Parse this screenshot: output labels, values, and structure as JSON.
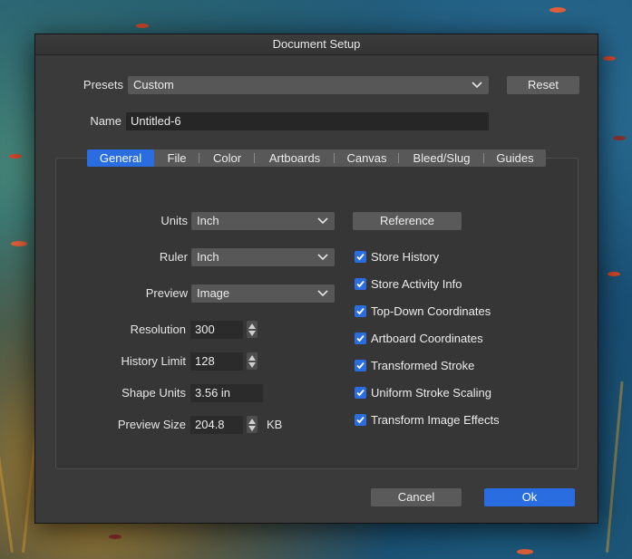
{
  "dialog": {
    "title": "Document Setup"
  },
  "presets": {
    "label": "Presets",
    "value": "Custom",
    "reset_label": "Reset"
  },
  "name": {
    "label": "Name",
    "value": "Untitled-6"
  },
  "tabs": [
    {
      "label": "General",
      "active": true
    },
    {
      "label": "File"
    },
    {
      "label": "Color"
    },
    {
      "label": "Artboards"
    },
    {
      "label": "Canvas"
    },
    {
      "label": "Bleed/Slug"
    },
    {
      "label": "Guides"
    }
  ],
  "general": {
    "units": {
      "label": "Units",
      "value": "Inch"
    },
    "ruler": {
      "label": "Ruler",
      "value": "Inch"
    },
    "preview": {
      "label": "Preview",
      "value": "Image"
    },
    "resolution": {
      "label": "Resolution",
      "value": "300"
    },
    "history_limit": {
      "label": "History Limit",
      "value": "128"
    },
    "shape_units": {
      "label": "Shape Units",
      "value": "3.56 in"
    },
    "preview_size": {
      "label": "Preview Size",
      "value": "204.8",
      "unit": "KB"
    },
    "reference_label": "Reference",
    "options": [
      {
        "label": "Store History",
        "checked": true
      },
      {
        "label": "Store Activity Info",
        "checked": true
      },
      {
        "label": "Top-Down Coordinates",
        "checked": true
      },
      {
        "label": "Artboard Coordinates",
        "checked": true
      },
      {
        "label": "Transformed Stroke",
        "checked": true
      },
      {
        "label": "Uniform Stroke Scaling",
        "checked": true
      },
      {
        "label": "Transform Image Effects",
        "checked": true
      }
    ]
  },
  "footer": {
    "cancel_label": "Cancel",
    "ok_label": "Ok"
  },
  "colors": {
    "accent": "#2a6de0",
    "dialog_bg": "#3a3a3a",
    "control_bg": "#575757",
    "field_bg": "#262626"
  }
}
